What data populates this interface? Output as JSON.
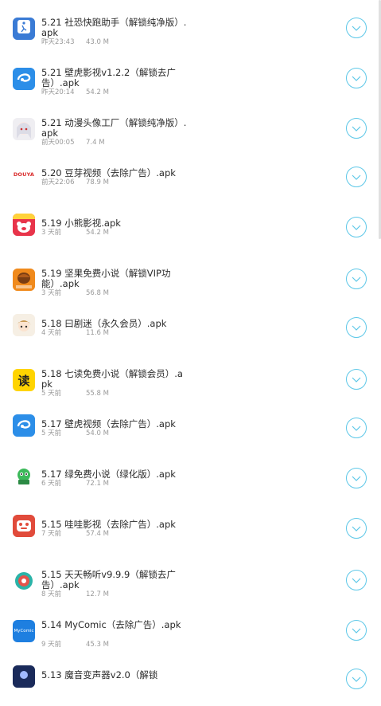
{
  "files": [
    {
      "title": "5.21 社恐快跑助手（解锁纯净版）.apk",
      "date": "昨天23:43",
      "size": "43.0 M",
      "icon": "runner-app-icon",
      "icon_bg": "#3a7bd5",
      "icon_text": "社恐"
    },
    {
      "title": "5.21 壁虎影视v1.2.2（解锁去广告）.apk",
      "date": "昨天20:14",
      "size": "54.2 M",
      "icon": "gecko-video-icon",
      "icon_bg": "#2c8ee8",
      "icon_text": ""
    },
    {
      "title": "5.21 动漫头像工厂（解锁纯净版）.apk",
      "date": "前天00:05",
      "size": "7.4 M",
      "icon": "anime-avatar-icon",
      "icon_bg": "#efeef2",
      "icon_text": ""
    },
    {
      "title": "5.20 豆芽视频（去除广告）.apk",
      "date": "前天22:06",
      "size": "78.9 M",
      "icon": "douya-logo-icon",
      "icon_bg": "#ffffff",
      "icon_text": "DOUYA"
    },
    {
      "title": "5.19 小熊影视.apk",
      "date": "3 天前",
      "size": "54.2 M",
      "icon": "bear-video-icon",
      "icon_bg": "#e8344a",
      "icon_text": ""
    },
    {
      "title": "5.19 坚果免费小说（解锁VIP功能）.apk",
      "date": "3 天前",
      "size": "56.8 M",
      "icon": "nut-novel-icon",
      "icon_bg": "#f08a1c",
      "icon_text": ""
    },
    {
      "title": "5.18 曰剧迷（永久会员）.apk",
      "date": "4 天前",
      "size": "11.6 M",
      "icon": "drama-fan-icon",
      "icon_bg": "#f6efe4",
      "icon_text": ""
    },
    {
      "title": "5.18 七读免费小说（解锁会员）.apk",
      "date": "5 天前",
      "size": "55.8 M",
      "icon": "qidu-read-icon",
      "icon_bg": "#ffd400",
      "icon_text": "读"
    },
    {
      "title": "5.17 壁虎视频（去除广告）.apk",
      "date": "5 天前",
      "size": "54.0 M",
      "icon": "gecko-video-icon",
      "icon_bg": "#2c8ee8",
      "icon_text": ""
    },
    {
      "title": "5.17 绿免费小说（绿化版）.apk",
      "date": "6 天前",
      "size": "72.1 M",
      "icon": "green-novel-icon",
      "icon_bg": "#ffffff",
      "icon_text": ""
    },
    {
      "title": "5.15 哇哇影视（去除广告）.apk",
      "date": "7 天前",
      "size": "57.4 M",
      "icon": "wawa-video-icon",
      "icon_bg": "#e14b3b",
      "icon_text": ""
    },
    {
      "title": "5.15 天天畅听v9.9.9（解锁去广告）.apk",
      "date": "8 天前",
      "size": "12.7 M",
      "icon": "daily-listen-icon",
      "icon_bg": "#ffffff",
      "icon_text": ""
    },
    {
      "title": "5.14 MyComic（去除广告）.apk",
      "date": "9 天前",
      "size": "45.3 M",
      "icon": "mycomic-logo-icon",
      "icon_bg": "#1e7fe0",
      "icon_text": "MyComic"
    },
    {
      "title": "5.13 魔音变声器v2.0（解锁",
      "date": "",
      "size": "",
      "icon": "voice-changer-icon",
      "icon_bg": "#1a2a5a",
      "icon_text": ""
    }
  ],
  "download_icon": "download-chevron-icon",
  "accent": "#5ec8e8"
}
